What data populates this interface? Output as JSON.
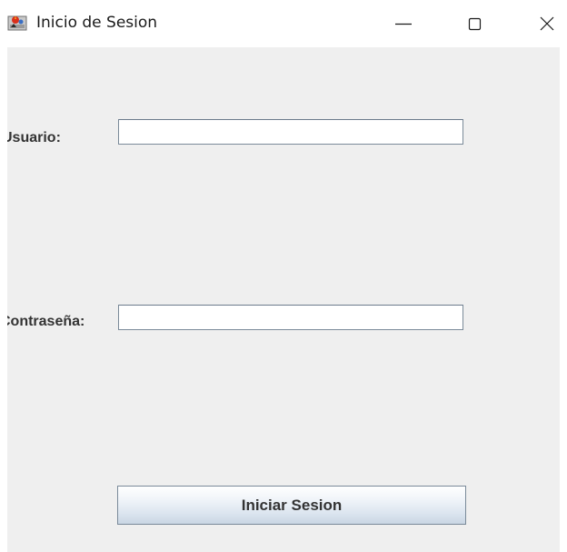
{
  "window": {
    "title": "Inicio de Sesion",
    "icon": "java-app-icon",
    "controls": {
      "minimize": "minimize-icon",
      "maximize": "maximize-icon",
      "close": "close-icon"
    }
  },
  "form": {
    "user_label": "Usuario:",
    "user_value": "",
    "password_label": "Contraseña:",
    "password_value": "",
    "submit_label": "Iniciar Sesion"
  },
  "colors": {
    "content_background": "#efefef",
    "titlebar_background": "#ffffff",
    "label_text": "#333333",
    "field_border": "#7a8a99"
  }
}
